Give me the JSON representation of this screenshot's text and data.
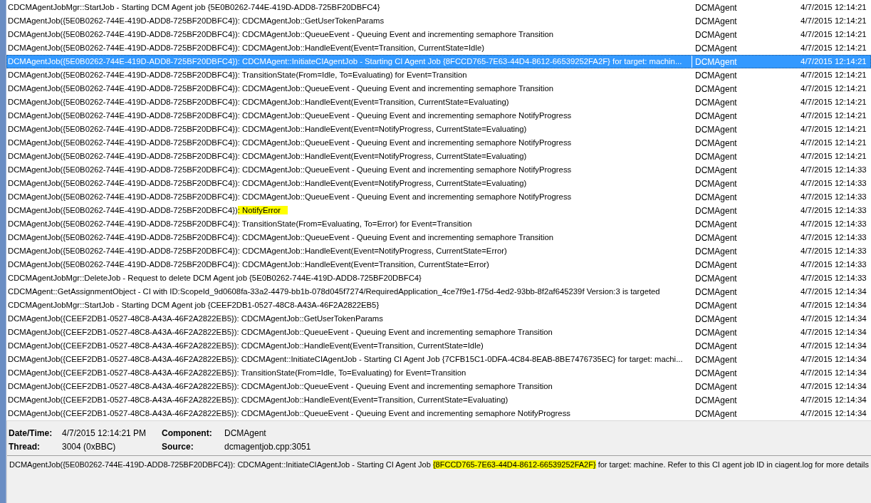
{
  "log_rows": [
    {
      "message": "CDCMAgentJobMgr::StartJob - Starting DCM Agent job {5E0B0262-744E-419D-ADD8-725BF20DBFC4}",
      "component": "DCMAgent",
      "date_time": "4/7/2015 12:14:21",
      "selected": false
    },
    {
      "message": "DCMAgentJob({5E0B0262-744E-419D-ADD8-725BF20DBFC4}): CDCMAgentJob::GetUserTokenParams",
      "component": "DCMAgent",
      "date_time": "4/7/2015 12:14:21",
      "selected": false
    },
    {
      "message": "DCMAgentJob({5E0B0262-744E-419D-ADD8-725BF20DBFC4}): CDCMAgentJob::QueueEvent - Queuing Event and incrementing semaphore Transition",
      "component": "DCMAgent",
      "date_time": "4/7/2015 12:14:21",
      "selected": false
    },
    {
      "message": "DCMAgentJob({5E0B0262-744E-419D-ADD8-725BF20DBFC4}): CDCMAgentJob::HandleEvent(Event=Transition, CurrentState=Idle)",
      "component": "DCMAgent",
      "date_time": "4/7/2015 12:14:21",
      "selected": false
    },
    {
      "message": "DCMAgentJob({5E0B0262-744E-419D-ADD8-725BF20DBFC4}): CDCMAgent::InitiateCIAgentJob - Starting CI Agent Job {8FCCD765-7E63-44D4-8612-66539252FA2F} for target: machin...",
      "component": "DCMAgent",
      "date_time": "4/7/2015 12:14:21",
      "selected": true
    },
    {
      "message": "DCMAgentJob({5E0B0262-744E-419D-ADD8-725BF20DBFC4}): TransitionState(From=Idle, To=Evaluating) for Event=Transition",
      "component": "DCMAgent",
      "date_time": "4/7/2015 12:14:21",
      "selected": false
    },
    {
      "message": "DCMAgentJob({5E0B0262-744E-419D-ADD8-725BF20DBFC4}): CDCMAgentJob::QueueEvent - Queuing Event and incrementing semaphore Transition",
      "component": "DCMAgent",
      "date_time": "4/7/2015 12:14:21",
      "selected": false
    },
    {
      "message": "DCMAgentJob({5E0B0262-744E-419D-ADD8-725BF20DBFC4}): CDCMAgentJob::HandleEvent(Event=Transition, CurrentState=Evaluating)",
      "component": "DCMAgent",
      "date_time": "4/7/2015 12:14:21",
      "selected": false
    },
    {
      "message": "DCMAgentJob({5E0B0262-744E-419D-ADD8-725BF20DBFC4}): CDCMAgentJob::QueueEvent - Queuing Event and incrementing semaphore NotifyProgress",
      "component": "DCMAgent",
      "date_time": "4/7/2015 12:14:21",
      "selected": false
    },
    {
      "message": "DCMAgentJob({5E0B0262-744E-419D-ADD8-725BF20DBFC4}): CDCMAgentJob::HandleEvent(Event=NotifyProgress, CurrentState=Evaluating)",
      "component": "DCMAgent",
      "date_time": "4/7/2015 12:14:21",
      "selected": false
    },
    {
      "message": "DCMAgentJob({5E0B0262-744E-419D-ADD8-725BF20DBFC4}): CDCMAgentJob::QueueEvent - Queuing Event and incrementing semaphore NotifyProgress",
      "component": "DCMAgent",
      "date_time": "4/7/2015 12:14:21",
      "selected": false
    },
    {
      "message": "DCMAgentJob({5E0B0262-744E-419D-ADD8-725BF20DBFC4}): CDCMAgentJob::HandleEvent(Event=NotifyProgress, CurrentState=Evaluating)",
      "component": "DCMAgent",
      "date_time": "4/7/2015 12:14:21",
      "selected": false
    },
    {
      "message": "DCMAgentJob({5E0B0262-744E-419D-ADD8-725BF20DBFC4}): CDCMAgentJob::QueueEvent - Queuing Event and incrementing semaphore NotifyProgress",
      "component": "DCMAgent",
      "date_time": "4/7/2015 12:14:33",
      "selected": false
    },
    {
      "message": "DCMAgentJob({5E0B0262-744E-419D-ADD8-725BF20DBFC4}): CDCMAgentJob::HandleEvent(Event=NotifyProgress, CurrentState=Evaluating)",
      "component": "DCMAgent",
      "date_time": "4/7/2015 12:14:33",
      "selected": false
    },
    {
      "message": "DCMAgentJob({5E0B0262-744E-419D-ADD8-725BF20DBFC4}): CDCMAgentJob::QueueEvent - Queuing Event and incrementing semaphore NotifyProgress",
      "component": "DCMAgent",
      "date_time": "4/7/2015 12:14:33",
      "selected": false
    },
    {
      "message": "DCMAgentJob({5E0B0262-744E-419D-ADD8-725BF20DBFC4})",
      "highlighted_part": ": NotifyError",
      "component": "DCMAgent",
      "date_time": "4/7/2015 12:14:33",
      "selected": false
    },
    {
      "message": "DCMAgentJob({5E0B0262-744E-419D-ADD8-725BF20DBFC4}): TransitionState(From=Evaluating, To=Error) for Event=Transition",
      "component": "DCMAgent",
      "date_time": "4/7/2015 12:14:33",
      "selected": false
    },
    {
      "message": "DCMAgentJob({5E0B0262-744E-419D-ADD8-725BF20DBFC4}): CDCMAgentJob::QueueEvent - Queuing Event and incrementing semaphore Transition",
      "component": "DCMAgent",
      "date_time": "4/7/2015 12:14:33",
      "selected": false
    },
    {
      "message": "DCMAgentJob({5E0B0262-744E-419D-ADD8-725BF20DBFC4}): CDCMAgentJob::HandleEvent(Event=NotifyProgress, CurrentState=Error)",
      "component": "DCMAgent",
      "date_time": "4/7/2015 12:14:33",
      "selected": false
    },
    {
      "message": "DCMAgentJob({5E0B0262-744E-419D-ADD8-725BF20DBFC4}): CDCMAgentJob::HandleEvent(Event=Transition, CurrentState=Error)",
      "component": "DCMAgent",
      "date_time": "4/7/2015 12:14:33",
      "selected": false
    },
    {
      "message": "CDCMAgentJobMgr::DeleteJob - Request to delete DCM Agent job {5E0B0262-744E-419D-ADD8-725BF20DBFC4}",
      "component": "DCMAgent",
      "date_time": "4/7/2015 12:14:33",
      "selected": false
    },
    {
      "message": "CDCMAgent::GetAssignmentObject - CI with ID:ScopeId_9d0608fa-33a2-4479-bb1b-078d045f7274/RequiredApplication_4ce7f9e1-f75d-4ed2-93bb-8f2af645239f Version:3 is targeted",
      "component": "DCMAgent",
      "date_time": "4/7/2015 12:14:34",
      "selected": false
    },
    {
      "message": "CDCMAgentJobMgr::StartJob - Starting DCM Agent job {CEEF2DB1-0527-48C8-A43A-46F2A2822EB5}",
      "component": "DCMAgent",
      "date_time": "4/7/2015 12:14:34",
      "selected": false
    },
    {
      "message": "DCMAgentJob({CEEF2DB1-0527-48C8-A43A-46F2A2822EB5}): CDCMAgentJob::GetUserTokenParams",
      "component": "DCMAgent",
      "date_time": "4/7/2015 12:14:34",
      "selected": false
    },
    {
      "message": "DCMAgentJob({CEEF2DB1-0527-48C8-A43A-46F2A2822EB5}): CDCMAgentJob::QueueEvent - Queuing Event and incrementing semaphore Transition",
      "component": "DCMAgent",
      "date_time": "4/7/2015 12:14:34",
      "selected": false
    },
    {
      "message": "DCMAgentJob({CEEF2DB1-0527-48C8-A43A-46F2A2822EB5}): CDCMAgentJob::HandleEvent(Event=Transition, CurrentState=Idle)",
      "component": "DCMAgent",
      "date_time": "4/7/2015 12:14:34",
      "selected": false
    },
    {
      "message": "DCMAgentJob({CEEF2DB1-0527-48C8-A43A-46F2A2822EB5}): CDCMAgent::InitiateCIAgentJob - Starting CI Agent Job {7CFB15C1-0DFA-4C84-8EAB-8BE7476735EC} for target: machi...",
      "component": "DCMAgent",
      "date_time": "4/7/2015 12:14:34",
      "selected": false
    },
    {
      "message": "DCMAgentJob({CEEF2DB1-0527-48C8-A43A-46F2A2822EB5}): TransitionState(From=Idle, To=Evaluating) for Event=Transition",
      "component": "DCMAgent",
      "date_time": "4/7/2015 12:14:34",
      "selected": false
    },
    {
      "message": "DCMAgentJob({CEEF2DB1-0527-48C8-A43A-46F2A2822EB5}): CDCMAgentJob::QueueEvent - Queuing Event and incrementing semaphore Transition",
      "component": "DCMAgent",
      "date_time": "4/7/2015 12:14:34",
      "selected": false
    },
    {
      "message": "DCMAgentJob({CEEF2DB1-0527-48C8-A43A-46F2A2822EB5}): CDCMAgentJob::HandleEvent(Event=Transition, CurrentState=Evaluating)",
      "component": "DCMAgent",
      "date_time": "4/7/2015 12:14:34",
      "selected": false
    },
    {
      "message": "DCMAgentJob({CEEF2DB1-0527-48C8-A43A-46F2A2822EB5}): CDCMAgentJob::QueueEvent - Queuing Event and incrementing semaphore NotifyProgress",
      "component": "DCMAgent",
      "date_time": "4/7/2015 12:14:34",
      "selected": false
    }
  ],
  "details": {
    "fields": [
      {
        "label": "Date/Time:",
        "value": "4/7/2015 12:14:21 PM"
      },
      {
        "label": "Component:",
        "value": "DCMAgent"
      },
      {
        "label": "Thread:",
        "value": "3004 (0xBBC)"
      },
      {
        "label": "Source:",
        "value": "dcmagentjob.cpp:3051"
      }
    ],
    "message": "DCMAgentJob({5E0B0262-744E-419D-ADD8-725BF20DBFC4}): CDCMAgent::InitiateCIAgentJob - Starting CI Agent Job ",
    "highlighted_part": "{8FCCD765-7E63-44D4-8612-66539252FA2F}",
    "message_end": " for target: machine. Refer to this CI agent job ID in ciagent.log for more details"
  }
}
